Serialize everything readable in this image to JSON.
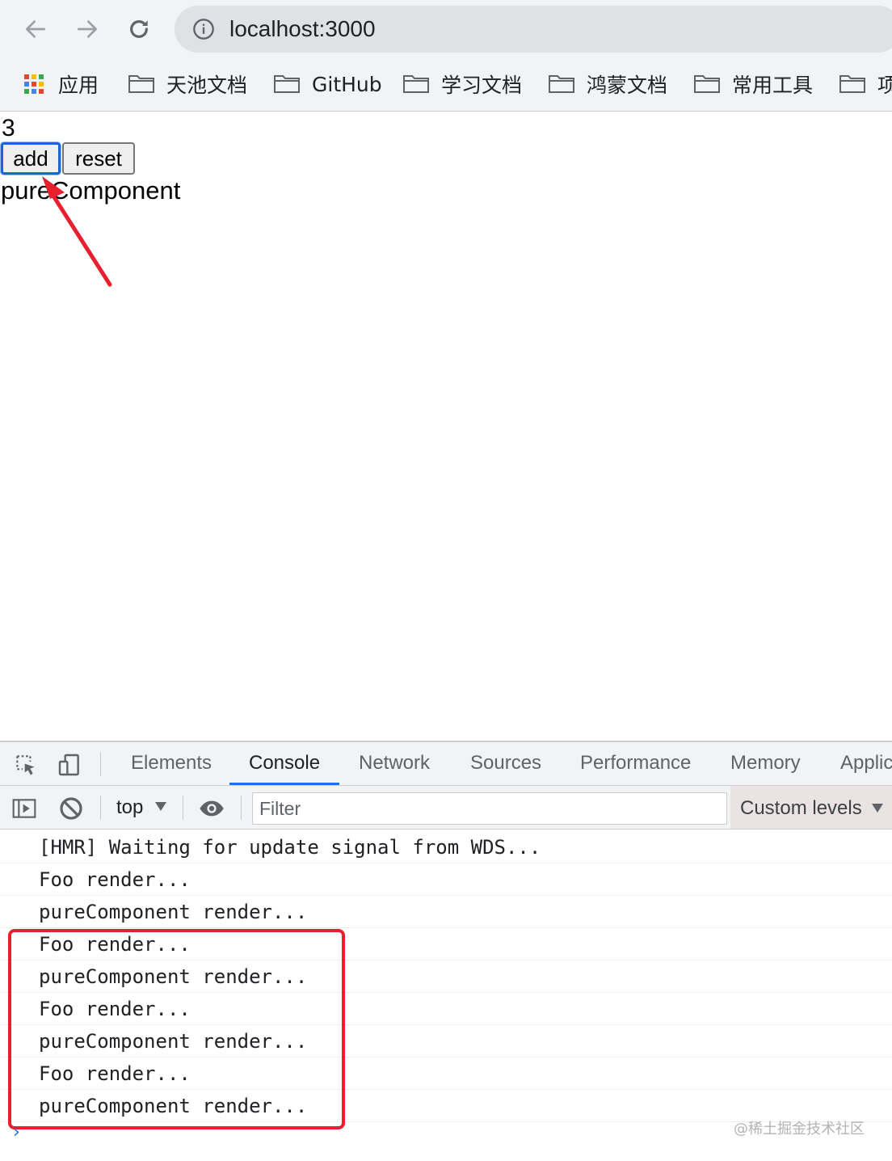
{
  "browser": {
    "url": "localhost:3000",
    "bookmarks": [
      {
        "label": "应用",
        "icon": "apps-grid-icon"
      },
      {
        "label": "天池文档",
        "icon": "folder-icon"
      },
      {
        "label": "GitHub",
        "icon": "folder-icon"
      },
      {
        "label": "学习文档",
        "icon": "folder-icon"
      },
      {
        "label": "鸿蒙文档",
        "icon": "folder-icon"
      },
      {
        "label": "常用工具",
        "icon": "folder-icon"
      },
      {
        "label": "项",
        "icon": "folder-icon"
      }
    ]
  },
  "page": {
    "count": "3",
    "add_label": "add",
    "reset_label": "reset",
    "component_label": "pureComponent"
  },
  "devtools": {
    "tabs": [
      "Elements",
      "Console",
      "Network",
      "Sources",
      "Performance",
      "Memory",
      "Applic"
    ],
    "active_tab": "Console",
    "context": "top",
    "filter_placeholder": "Filter",
    "levels_label": "Custom levels",
    "console_lines": [
      "[HMR] Waiting for update signal from WDS...",
      "Foo render...",
      "pureComponent render...",
      "Foo render...",
      "pureComponent render...",
      "Foo render...",
      "pureComponent render...",
      "Foo render...",
      "pureComponent render..."
    ],
    "prompt": "›"
  },
  "annotations": {
    "highlight_color": "#e8202e",
    "watermark": "@稀土掘金技术社区"
  }
}
